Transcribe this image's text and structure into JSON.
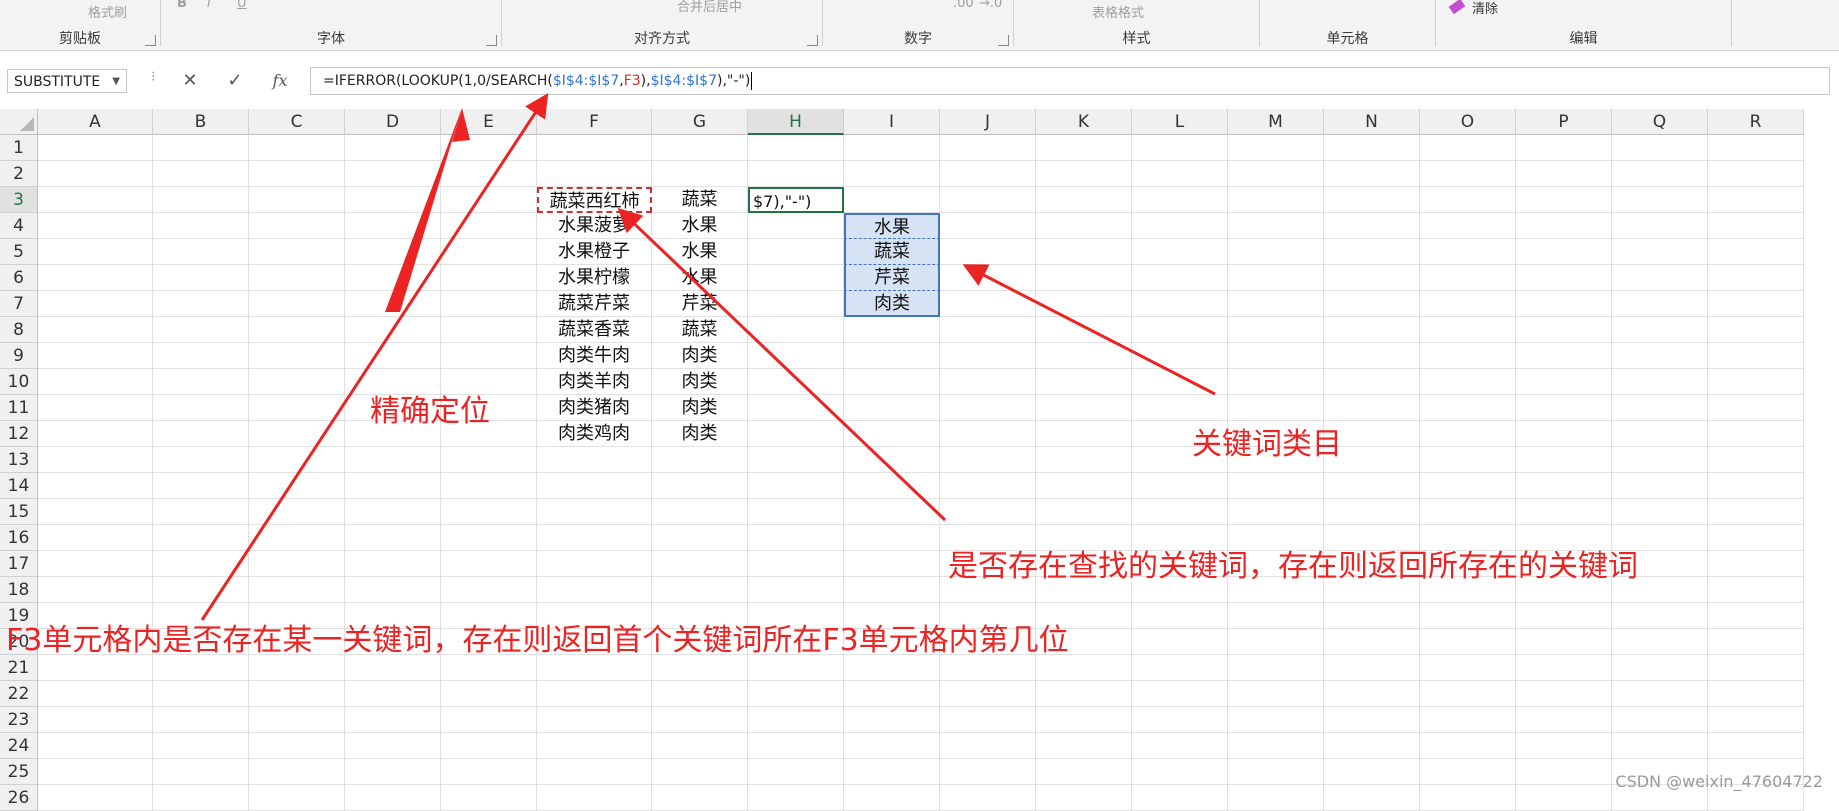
{
  "ribbon": {
    "groups": [
      {
        "name": "剪贴板",
        "items": [
          "格式刷"
        ]
      },
      {
        "name": "字体",
        "items": [
          "B",
          "I",
          "U"
        ]
      },
      {
        "name": "对齐方式",
        "items": [
          "合并后居中"
        ]
      },
      {
        "name": "数字",
        "items": [
          ".00",
          "→.0"
        ]
      },
      {
        "name": "样式",
        "items": [
          "表格格式"
        ]
      },
      {
        "name": "单元格",
        "items": []
      },
      {
        "name": "编辑",
        "items": [
          "清除"
        ]
      }
    ]
  },
  "formula_bar": {
    "name_box": "SUBSTITUTE",
    "cancel": "✕",
    "enter": "✓",
    "fx": "fx",
    "formula_parts": [
      {
        "text": "=IFERROR(LOOKUP(1,0/SEARCH(",
        "color": "dark"
      },
      {
        "text": "$I$4:$I$7",
        "color": "blue"
      },
      {
        "text": ",",
        "color": "dark"
      },
      {
        "text": "F3",
        "color": "red"
      },
      {
        "text": "),",
        "color": "dark"
      },
      {
        "text": "$I$4:$I$7",
        "color": "blue"
      },
      {
        "text": "),\"-\")",
        "color": "dark"
      }
    ]
  },
  "sheet": {
    "columns": [
      "A",
      "B",
      "C",
      "D",
      "E",
      "F",
      "G",
      "H",
      "I",
      "J",
      "K",
      "L",
      "M",
      "N",
      "O",
      "P",
      "Q",
      "R"
    ],
    "rows": [
      "1",
      "2",
      "3",
      "4",
      "5",
      "6",
      "7",
      "8",
      "9",
      "10",
      "11",
      "12",
      "13",
      "14",
      "15",
      "16",
      "17",
      "18",
      "19",
      "20",
      "21",
      "22",
      "23",
      "24",
      "25",
      "26"
    ],
    "selected_column": "H",
    "selected_row": "3",
    "column_F": [
      "蔬菜西红柿",
      "水果菠萝",
      "水果橙子",
      "水果柠檬",
      "蔬菜芹菜",
      "蔬菜香菜",
      "肉类牛肉",
      "肉类羊肉",
      "肉类猪肉",
      "肉类鸡肉"
    ],
    "column_G": [
      "蔬菜",
      "水果",
      "水果",
      "水果",
      "芹菜",
      "蔬菜",
      "肉类",
      "肉类",
      "肉类",
      "肉类"
    ],
    "H3_editing": "$7),\"-\")",
    "column_I": [
      "水果",
      "蔬菜",
      "芹菜",
      "肉类"
    ]
  },
  "annotations": {
    "precise": "精确定位",
    "category": "关键词类目",
    "exists": "是否存在查找的关键词，存在则返回所存在的关键词",
    "f3": "F3单元格内是否存在某一关键词，存在则返回首个关键词所在F3单元格内第几位",
    "color": "#ec2323"
  },
  "watermark": "CSDN @weixin_47604722"
}
